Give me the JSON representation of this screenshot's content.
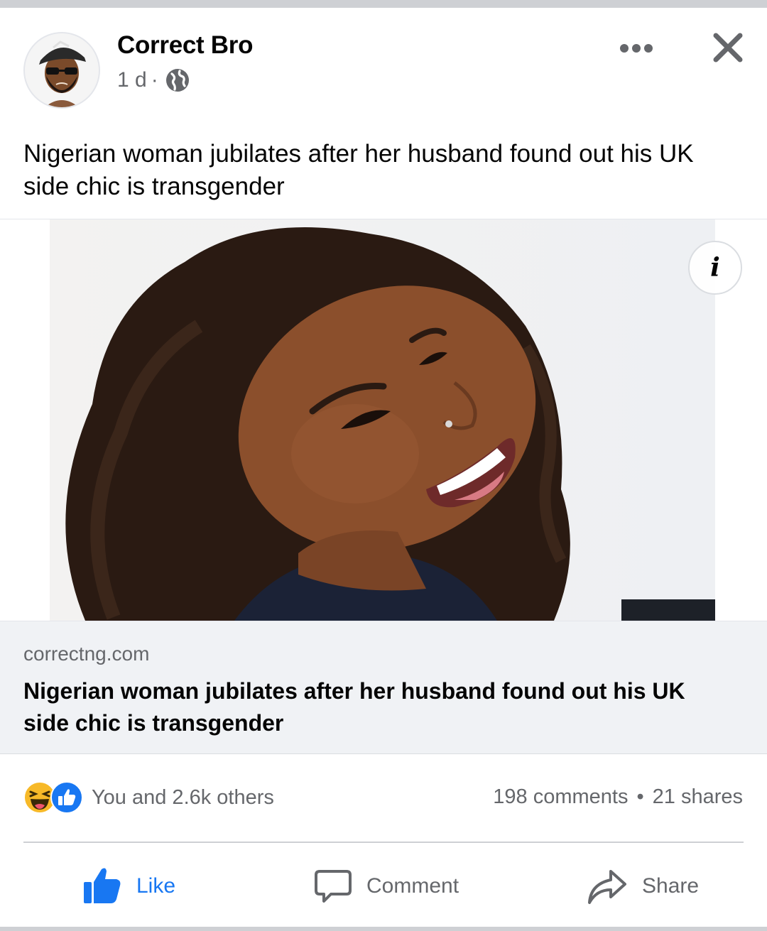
{
  "post": {
    "author": "Correct Bro",
    "time": "1 d",
    "separator": "·",
    "visibility_icon": "globe-icon",
    "text": "Nigerian woman jubilates after her husband found out his UK side chic is transgender",
    "menu_icon": "more-options-icon",
    "close_icon": "close-icon"
  },
  "link_preview": {
    "image_description_icon": "info-icon",
    "info_glyph": "i",
    "domain": "correctng.com",
    "title": "Nigerian woman jubilates after her husband found out his UK side chic is transgender"
  },
  "engagement": {
    "reaction_icons": [
      "haha-reaction-icon",
      "like-reaction-icon"
    ],
    "reactions_text": "You and 2.6k others",
    "comments": "198 comments",
    "dot": "•",
    "shares": "21 shares"
  },
  "actions": {
    "like": "Like",
    "comment": "Comment",
    "share": "Share"
  },
  "colors": {
    "brand_blue": "#1877f2",
    "secondary_text": "#65676b",
    "card_background": "#f0f2f5",
    "divider": "#ced0d4"
  }
}
